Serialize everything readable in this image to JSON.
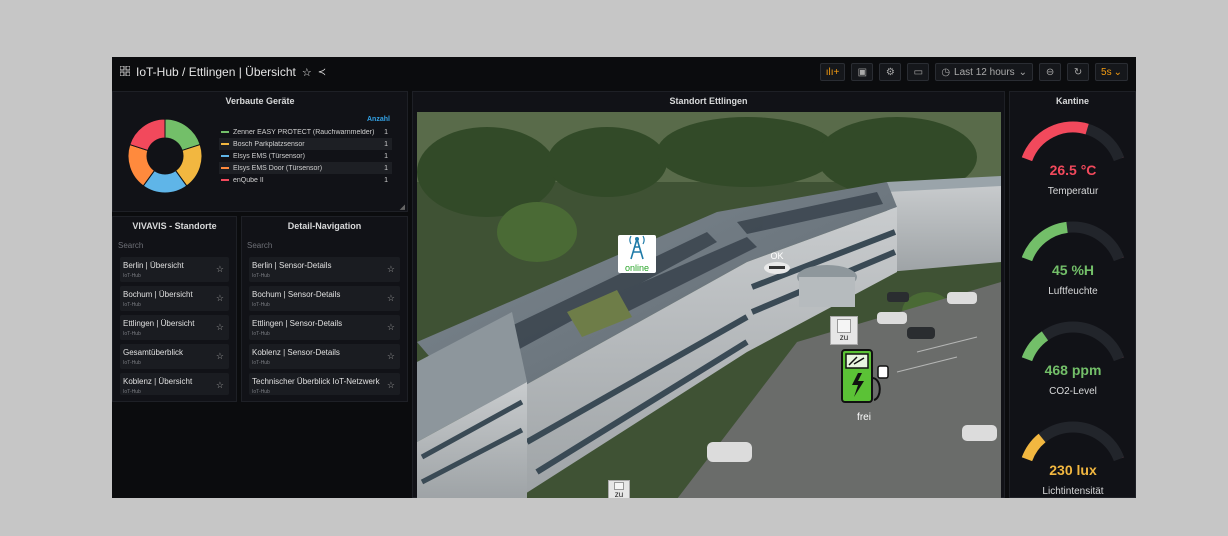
{
  "topbar": {
    "grid_icon": "grid-icon",
    "breadcrumb": "IoT-Hub / Ettlingen | Übersicht",
    "time_range": "Last 12 hours",
    "refresh_interval": "5s"
  },
  "devices_panel": {
    "title": "Verbaute Geräte",
    "legend_header": "Anzahl",
    "items": [
      {
        "name": "Zenner EASY PROTECT (Rauchwarnmelder)",
        "count": "1",
        "color": "#73bf69"
      },
      {
        "name": "Bosch Parkplatzsensor",
        "count": "1",
        "color": "#f2b740"
      },
      {
        "name": "Elsys EMS (Türsensor)",
        "count": "1",
        "color": "#5fb5e8"
      },
      {
        "name": "Elsys EMS Door (Türsensor)",
        "count": "1",
        "color": "#ff8a3d"
      },
      {
        "name": "enQube II",
        "count": "1",
        "color": "#f2495c"
      }
    ]
  },
  "vivavis_panel": {
    "title": "VIVAVIS - Standorte",
    "search_placeholder": "Search",
    "items": [
      {
        "title": "Berlin | Übersicht",
        "sub": "IoT-Hub"
      },
      {
        "title": "Bochum | Übersicht",
        "sub": "IoT-Hub"
      },
      {
        "title": "Ettlingen | Übersicht",
        "sub": "IoT-Hub"
      },
      {
        "title": "Gesamtüberblick",
        "sub": "IoT-Hub"
      },
      {
        "title": "Koblenz | Übersicht",
        "sub": "IoT-Hub"
      }
    ]
  },
  "detail_panel": {
    "title": "Detail-Navigation",
    "search_placeholder": "Search",
    "items": [
      {
        "title": "Berlin | Sensor-Details",
        "sub": "IoT-Hub"
      },
      {
        "title": "Bochum | Sensor-Details",
        "sub": "IoT-Hub"
      },
      {
        "title": "Ettlingen | Sensor-Details",
        "sub": "IoT-Hub"
      },
      {
        "title": "Koblenz | Sensor-Details",
        "sub": "IoT-Hub"
      },
      {
        "title": "Technischer Überblick IoT-Netzwerk",
        "sub": "IoT-Hub"
      }
    ]
  },
  "map_panel": {
    "title": "Standort Ettlingen",
    "overlays": {
      "gateway": "online",
      "smoke": "OK",
      "door1": "zu",
      "charger": "frei",
      "door2": "zu"
    }
  },
  "kantine_panel": {
    "title": "Kantine",
    "gauges": [
      {
        "value": "26.5 °C",
        "label": "Temperatur",
        "color": "#f2495c",
        "fraction": 0.62
      },
      {
        "value": "45 %H",
        "label": "Luftfeuchte",
        "color": "#73bf69",
        "fraction": 0.45
      },
      {
        "value": "468 ppm",
        "label": "CO2-Level",
        "color": "#73bf69",
        "fraction": 0.25
      },
      {
        "value": "230 lux",
        "label": "Lichtintensität",
        "color": "#f2b740",
        "fraction": 0.22
      }
    ]
  }
}
